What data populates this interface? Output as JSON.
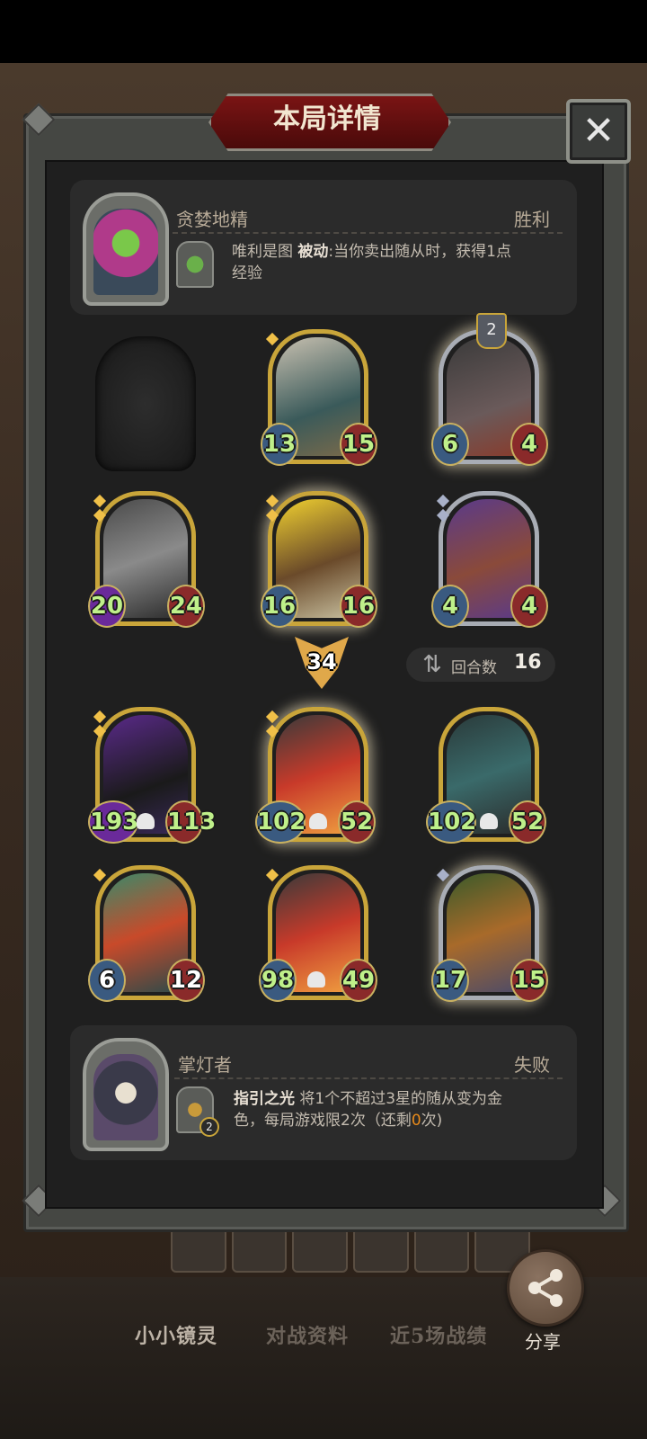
{
  "dialog": {
    "title": "本局详情",
    "close_icon": "✕"
  },
  "winner": {
    "name": "贪婪地精",
    "result": "胜利",
    "skill_name": "唯利是图",
    "skill_type": "被动",
    "skill_desc_1": ":当你卖出随从时，获得1点",
    "skill_desc_2": "经验"
  },
  "loser": {
    "name": "掌灯者",
    "result": "失败",
    "skill_name": "指引之光",
    "skill_desc_1": "将1个不超过3星的随从变为金",
    "skill_desc_2a": "色，每局游戏限2次（还剩",
    "skill_remaining": "0",
    "skill_desc_2b": "次)",
    "skill_badge": "2"
  },
  "top_board": {
    "level_badge": "2",
    "cards": [
      {
        "atk": "13",
        "hp": "15"
      },
      {
        "atk": "6",
        "hp": "4"
      },
      {
        "atk": "20",
        "hp": "24"
      },
      {
        "atk": "16",
        "hp": "16"
      },
      {
        "atk": "4",
        "hp": "4"
      }
    ]
  },
  "damage": "34",
  "turns": {
    "label": "回合数",
    "value": "16"
  },
  "bottom_board": {
    "cards": [
      {
        "atk": "193",
        "hp": "113"
      },
      {
        "atk": "102",
        "hp": "52"
      },
      {
        "atk": "102",
        "hp": "52"
      },
      {
        "atk": "6",
        "hp": "12"
      },
      {
        "atk": "98",
        "hp": "49"
      },
      {
        "atk": "17",
        "hp": "15"
      }
    ]
  },
  "tabs": [
    "小小镜灵",
    "对战资料",
    "近5场战绩"
  ],
  "share": {
    "label": "分享",
    "icon": "share-icon"
  }
}
